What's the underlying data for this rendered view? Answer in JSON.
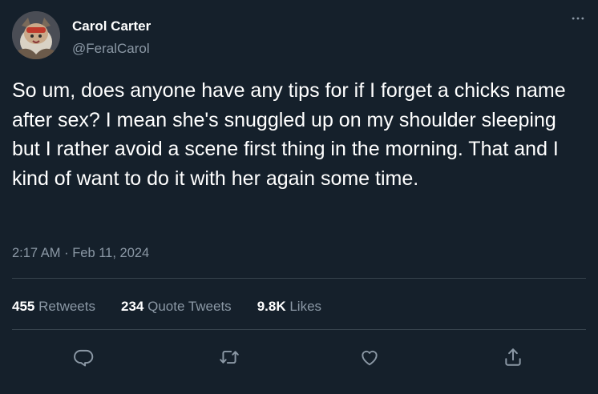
{
  "author": {
    "display_name": "Carol Carter",
    "handle": "@FeralCarol"
  },
  "tweet": {
    "text": "So um, does anyone have any tips for if I forget a chicks name after sex? I mean she's snuggled up on my shoulder sleeping but I rather avoid a scene first thing in the morning. That and I kind of want to do it with her again some time.",
    "timestamp": "2:17 AM · Feb 11, 2024"
  },
  "stats": {
    "retweets_count": "455",
    "retweets_label": "Retweets",
    "quote_count": "234",
    "quote_label": "Quote Tweets",
    "likes_count": "9.8K",
    "likes_label": "Likes"
  },
  "icons": {
    "more": "more-horizontal-icon",
    "reply": "reply-icon",
    "retweet": "retweet-icon",
    "like": "heart-icon",
    "share": "share-icon"
  },
  "colors": {
    "background": "#15202b",
    "text_primary": "#ffffff",
    "text_secondary": "#8b98a5",
    "divider": "#38444d"
  }
}
